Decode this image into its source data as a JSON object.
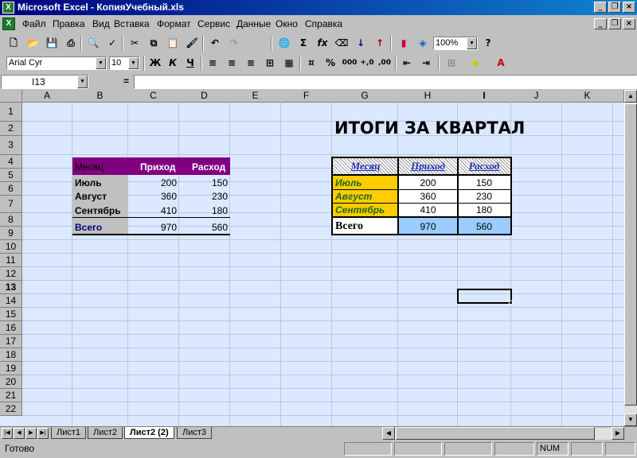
{
  "window": {
    "title": "Microsoft Excel - КопияУчебный.xls",
    "app_icon": "excel-icon"
  },
  "menu": [
    "Файл",
    "Правка",
    "Вид",
    "Вставка",
    "Формат",
    "Сервис",
    "Данные",
    "Окно",
    "Справка"
  ],
  "toolbar": {
    "zoom": "100%",
    "font_name": "Arial Cyr",
    "font_size": "10",
    "bold": "Ж",
    "italic": "К",
    "underline": "Ч",
    "percent": "%",
    "thousands": "000",
    "sum": "Σ",
    "fx": "fx"
  },
  "formula_bar": {
    "cell_ref": "I13",
    "equals": "=",
    "content": ""
  },
  "columns": [
    "A",
    "B",
    "C",
    "D",
    "E",
    "F",
    "G",
    "H",
    "I",
    "J",
    "K"
  ],
  "rows": [
    "1",
    "2",
    "3",
    "4",
    "5",
    "6",
    "7",
    "8",
    "9",
    "10",
    "11",
    "12",
    "13",
    "14",
    "15",
    "16",
    "17",
    "18",
    "19",
    "20",
    "21",
    "22"
  ],
  "selected_cell": {
    "column": "I",
    "row": "13"
  },
  "heading": "ИТОГИ ЗА КВАРТАЛ",
  "table1": {
    "headers": [
      "Месяц",
      "Приход",
      "Расход"
    ],
    "rows": [
      [
        "Июль",
        "200",
        "150"
      ],
      [
        "Август",
        "360",
        "230"
      ],
      [
        "Сентябрь",
        "410",
        "180"
      ]
    ],
    "total": [
      "Всего",
      "970",
      "560"
    ],
    "header_color": "#800080"
  },
  "table2": {
    "headers": [
      "Месяц",
      "Приход",
      "Расход"
    ],
    "rows": [
      [
        "Июль",
        "200",
        "150"
      ],
      [
        "Август",
        "360",
        "230"
      ],
      [
        "Сентябрь",
        "410",
        "180"
      ]
    ],
    "total": [
      "Всего",
      "970",
      "560"
    ],
    "month_fill": "#ffcc00",
    "total_fill": "#99ccff"
  },
  "sheets": [
    "Лист1",
    "Лист2",
    "Лист2 (2)",
    "Лист3"
  ],
  "active_sheet": "Лист2 (2)",
  "status": {
    "text": "Готово",
    "num": "NUM"
  }
}
